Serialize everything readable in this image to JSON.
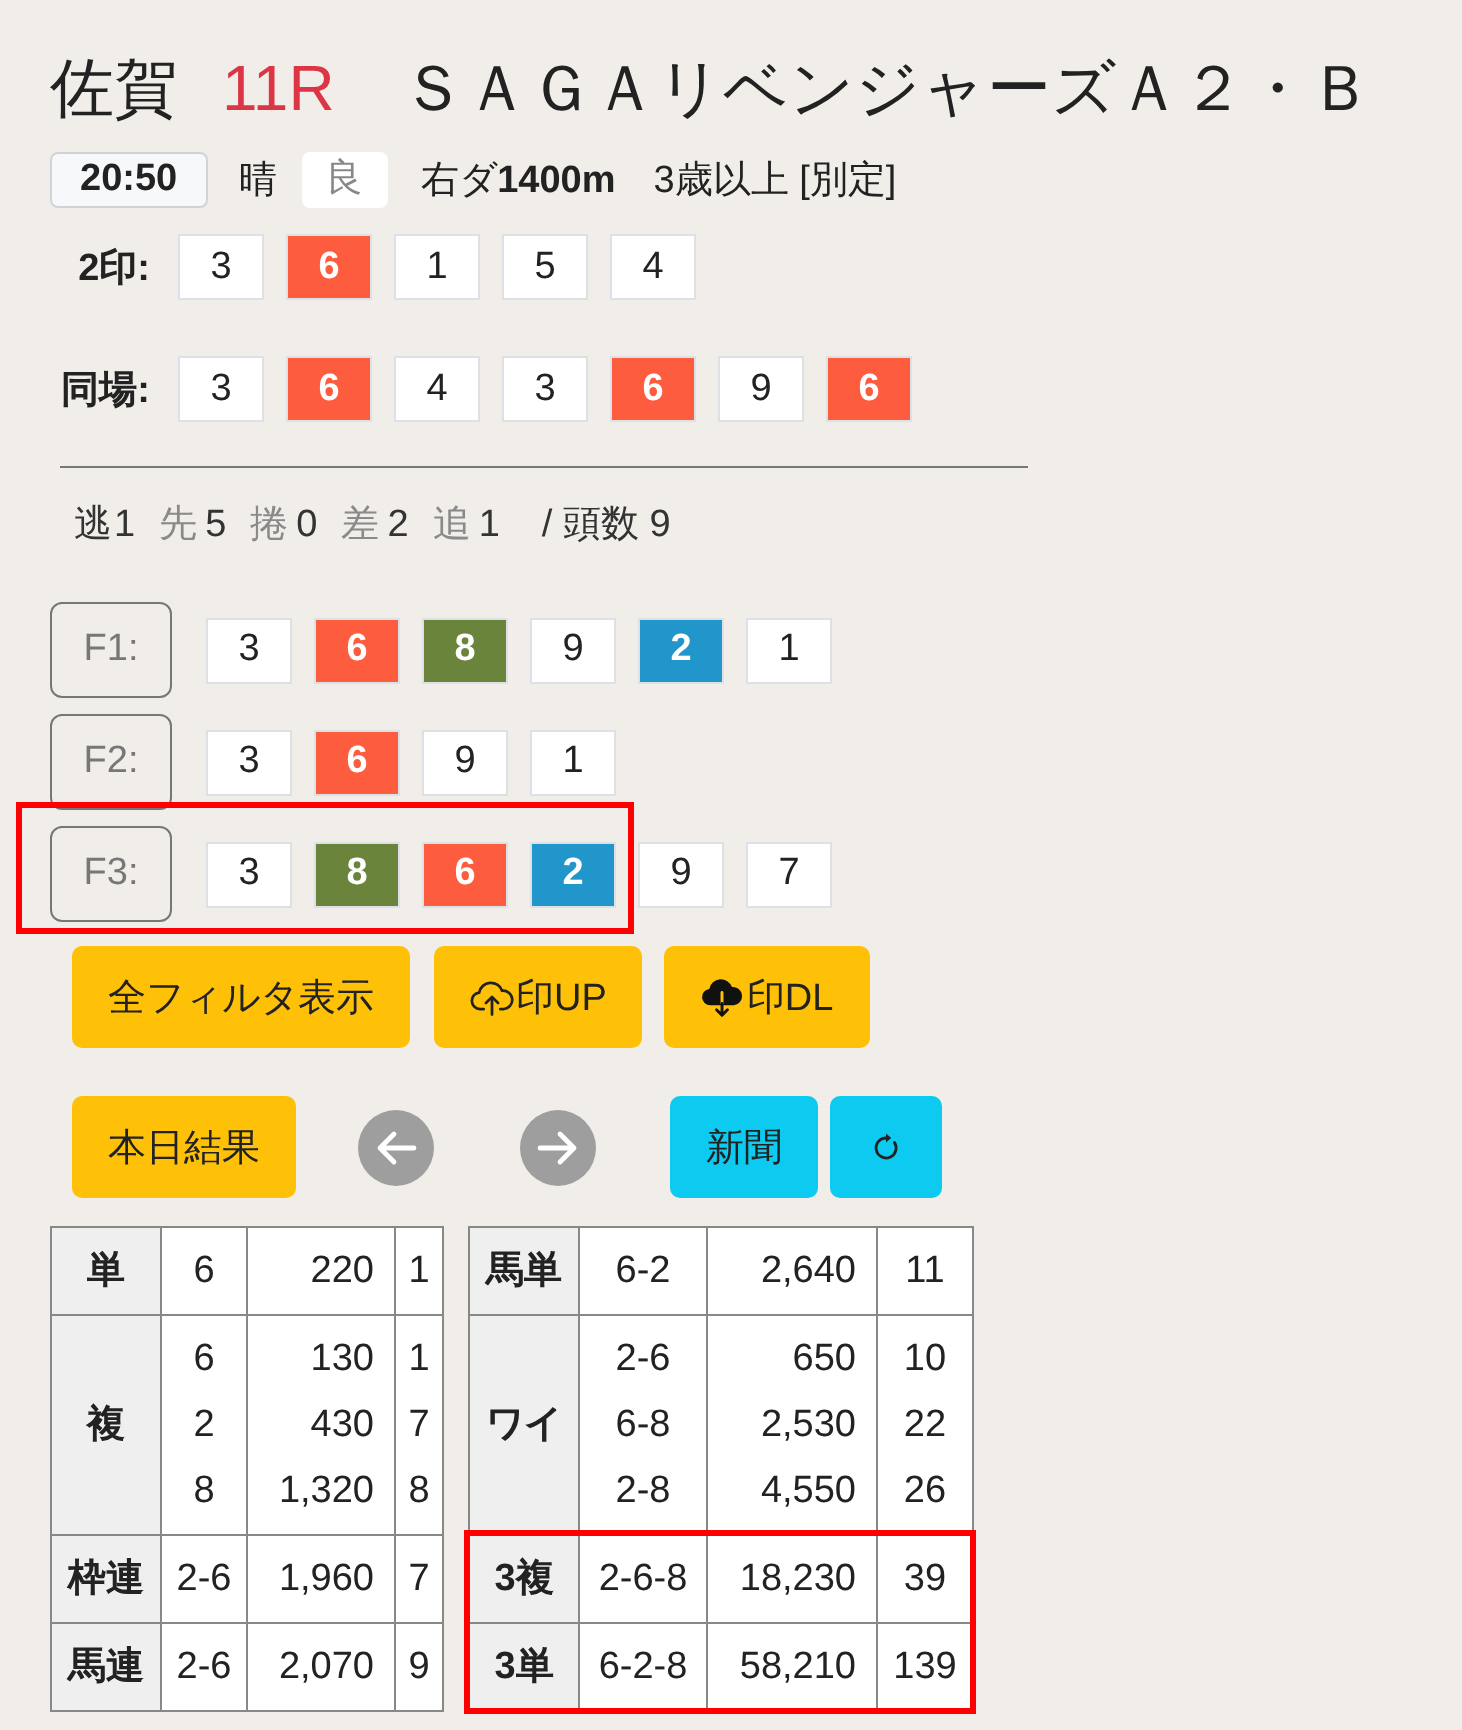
{
  "header": {
    "venue": "佐賀",
    "race_number": "11R",
    "race_name": "ＳＡＧＡリベンジャーズＡ２・Ｂ"
  },
  "race_info": {
    "post_time": "20:50",
    "weather": "晴",
    "track_condition": "良",
    "course": "右ダ**1400m**",
    "conditions": "3歳以上 [別定]"
  },
  "mark_rows": [
    {
      "label": "2印:",
      "numbers": [
        {
          "text": "3",
          "color": "#ffffff"
        },
        {
          "text": "6",
          "color": "#fd5d3e"
        },
        {
          "text": "1",
          "color": "#ffffff"
        },
        {
          "text": "5",
          "color": "#ffffff"
        },
        {
          "text": "4",
          "color": "#ffffff"
        }
      ]
    },
    {
      "label": "同場:",
      "numbers": [
        {
          "text": "3",
          "color": "#ffffff"
        },
        {
          "text": "6",
          "color": "#fd5d3e"
        },
        {
          "text": "4",
          "color": "#ffffff"
        },
        {
          "text": "3",
          "color": "#ffffff"
        },
        {
          "text": "6",
          "color": "#fd5d3e"
        },
        {
          "text": "9",
          "color": "#ffffff"
        },
        {
          "text": "6",
          "color": "#fd5d3e"
        }
      ]
    }
  ],
  "running_styles": {
    "items": [
      {
        "label": "逃",
        "count": "1",
        "emphasized": true
      },
      {
        "label": "先",
        "count": "5",
        "emphasized": false
      },
      {
        "label": "捲",
        "count": "0",
        "emphasized": false
      },
      {
        "label": "差",
        "count": "2",
        "emphasized": false
      },
      {
        "label": "追",
        "count": "1",
        "emphasized": false
      }
    ],
    "field_size": "/ 頭数 9"
  },
  "filters": [
    {
      "label": "F1:",
      "highlighted": false,
      "numbers": [
        {
          "text": "3",
          "color": "#ffffff"
        },
        {
          "text": "6",
          "color": "#fd5d3e"
        },
        {
          "text": "8",
          "color": "#6b843b"
        },
        {
          "text": "9",
          "color": "#ffffff"
        },
        {
          "text": "2",
          "color": "#2196cb"
        },
        {
          "text": "1",
          "color": "#ffffff"
        }
      ]
    },
    {
      "label": "F2:",
      "highlighted": false,
      "numbers": [
        {
          "text": "3",
          "color": "#ffffff"
        },
        {
          "text": "6",
          "color": "#fd5d3e"
        },
        {
          "text": "9",
          "color": "#ffffff"
        },
        {
          "text": "1",
          "color": "#ffffff"
        }
      ]
    },
    {
      "label": "F3:",
      "highlighted": true,
      "numbers": [
        {
          "text": "3",
          "color": "#ffffff"
        },
        {
          "text": "8",
          "color": "#6b843b"
        },
        {
          "text": "6",
          "color": "#fd5d3e"
        },
        {
          "text": "2",
          "color": "#2196cb"
        }
      ],
      "trailing_numbers": [
        {
          "text": "9",
          "color": "#ffffff"
        },
        {
          "text": "7",
          "color": "#ffffff"
        }
      ]
    }
  ],
  "button_rows": [
    [
      {
        "kind": "plain",
        "label": "全フィルタ表示",
        "color": "#ffc107"
      },
      {
        "kind": "upload",
        "label": "印UP",
        "color": "#ffc107"
      },
      {
        "kind": "download",
        "label": "印DL",
        "color": "#ffc107"
      }
    ],
    [
      {
        "kind": "plain",
        "label": "本日結果",
        "color": "#ffc107"
      },
      {
        "kind": "prev"
      },
      {
        "kind": "next"
      },
      {
        "kind": "plain",
        "label": "新聞",
        "color": "#0dcaf0"
      },
      {
        "kind": "refresh",
        "color": "#0dcaf0"
      }
    ]
  ],
  "payout_tables": [
    {
      "rows": [
        {
          "bet_type": "単",
          "combinations": [
            "6"
          ],
          "payouts": [
            "220"
          ],
          "popularity": [
            "1"
          ],
          "highlighted": false
        },
        {
          "bet_type": "複",
          "combinations": [
            "6",
            "2",
            "8"
          ],
          "payouts": [
            "130",
            "430",
            "1,320"
          ],
          "popularity": [
            "1",
            "7",
            "8"
          ],
          "highlighted": false
        },
        {
          "bet_type": "枠連",
          "combinations": [
            "2-6"
          ],
          "payouts": [
            "1,960"
          ],
          "popularity": [
            "7"
          ],
          "highlighted": false
        },
        {
          "bet_type": "馬連",
          "combinations": [
            "2-6"
          ],
          "payouts": [
            "2,070"
          ],
          "popularity": [
            "9"
          ],
          "highlighted": false
        }
      ]
    },
    {
      "rows": [
        {
          "bet_type": "馬単",
          "combinations": [
            "6-2"
          ],
          "payouts": [
            "2,640"
          ],
          "popularity": [
            "11"
          ],
          "highlighted": false
        },
        {
          "bet_type": "ワイ",
          "combinations": [
            "2-6",
            "6-8",
            "2-8"
          ],
          "payouts": [
            "650",
            "2,530",
            "4,550"
          ],
          "popularity": [
            "10",
            "22",
            "26"
          ],
          "highlighted": false
        },
        {
          "bet_type": "3複",
          "combinations": [
            "2-6-8"
          ],
          "payouts": [
            "18,230"
          ],
          "popularity": [
            "39"
          ],
          "highlighted": true
        },
        {
          "bet_type": "3単",
          "combinations": [
            "6-2-8"
          ],
          "payouts": [
            "58,210"
          ],
          "popularity": [
            "139"
          ],
          "highlighted": true
        }
      ]
    }
  ]
}
